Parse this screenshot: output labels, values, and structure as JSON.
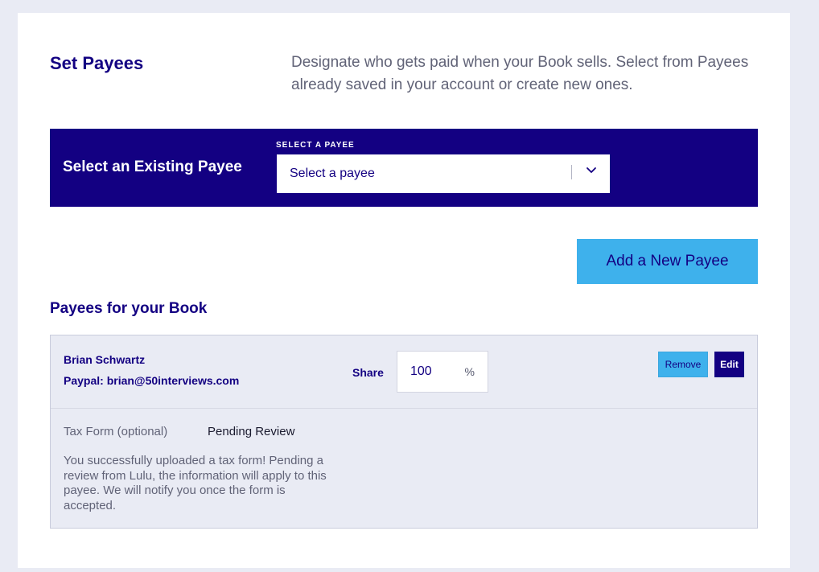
{
  "header": {
    "title": "Set Payees",
    "description": "Designate who gets paid when your Book sells. Select from Payees already saved in your account or create new ones."
  },
  "select_panel": {
    "heading": "Select an Existing Payee",
    "field_label": "SELECT A PAYEE",
    "selected_value": "Select a payee",
    "chevron_icon": "chevron-down-icon"
  },
  "actions": {
    "add_payee_label": "Add a New Payee"
  },
  "payees_section": {
    "title": "Payees for your Book",
    "payees": [
      {
        "name": "Brian Schwartz",
        "paypal": "Paypal: brian@50interviews.com",
        "share_label": "Share",
        "share_value": "100",
        "share_unit": "%",
        "remove_label": "Remove",
        "edit_label": "Edit",
        "tax_form_label": "Tax Form (optional)",
        "tax_form_status": "Pending Review",
        "tax_message": "You successfully uploaded a tax form! Pending a review from Lulu, the information will apply to this payee. We will notify you once the form is accepted."
      }
    ]
  },
  "colors": {
    "page_background": "#e9ebf4",
    "brand_navy": "#130082",
    "accent_blue": "#3eb1ec",
    "muted_text": "#616377"
  }
}
